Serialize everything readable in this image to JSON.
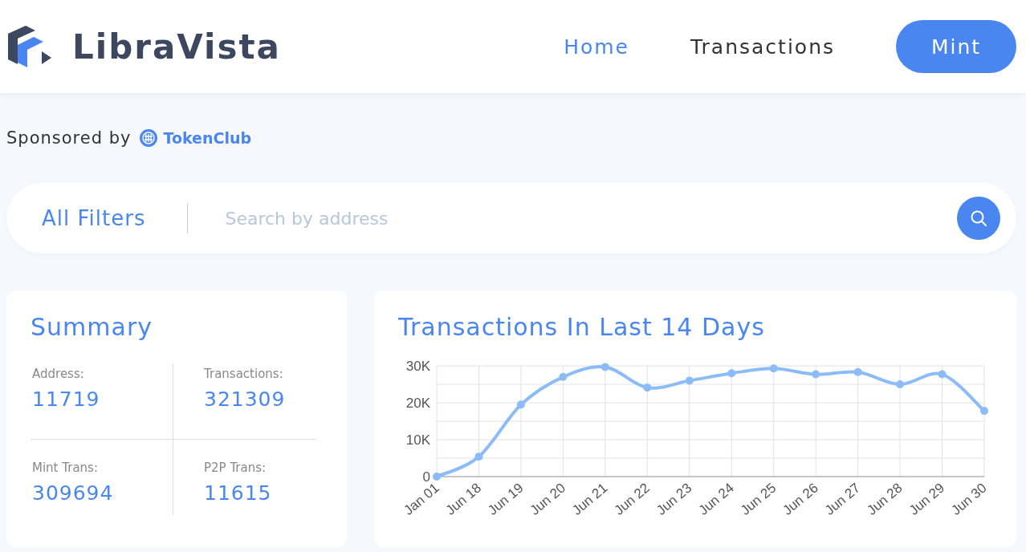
{
  "header": {
    "logo": "LibraVista",
    "nav": [
      {
        "label": "Home",
        "selected": true
      },
      {
        "label": "Transactions",
        "selected": false
      }
    ],
    "action_button": "Mint"
  },
  "sponsor": {
    "label": "Sponsored by",
    "brand": "TokenClub"
  },
  "search": {
    "filter": "All Filters",
    "placeholder": "Search by address"
  },
  "summary": {
    "title": "Summary",
    "stats": [
      {
        "label": "Address:",
        "value": "11719"
      },
      {
        "label": "Transactions:",
        "value": "321309"
      },
      {
        "label": "Mint Trans:",
        "value": "309694"
      },
      {
        "label": "P2P Trans:",
        "value": "11615"
      }
    ]
  },
  "chart_panel": {
    "title": "Transactions In Last 14 Days",
    "chart_data": {
      "type": "line",
      "categories": [
        "Jan 01",
        "Jun 18",
        "Jun 19",
        "Jun 20",
        "Jun 21",
        "Jun 22",
        "Jun 23",
        "Jun 24",
        "Jun 25",
        "Jun 26",
        "Jun 27",
        "Jun 28",
        "Jun 29",
        "Jun 30"
      ],
      "series": [
        {
          "color": "#8bbcf7",
          "marker": true,
          "values": [
            0,
            5400,
            19500,
            27000,
            29700,
            24100,
            26000,
            28000,
            29300,
            27700,
            28300,
            25000,
            27700,
            17800
          ]
        }
      ],
      "ylim": [
        0,
        30000
      ],
      "yticks": [
        {
          "value": 0,
          "label": "0"
        },
        {
          "value": 10000,
          "label": "10K"
        },
        {
          "value": 20000,
          "label": "20K"
        },
        {
          "value": 30000,
          "label": "30K"
        }
      ]
    }
  }
}
